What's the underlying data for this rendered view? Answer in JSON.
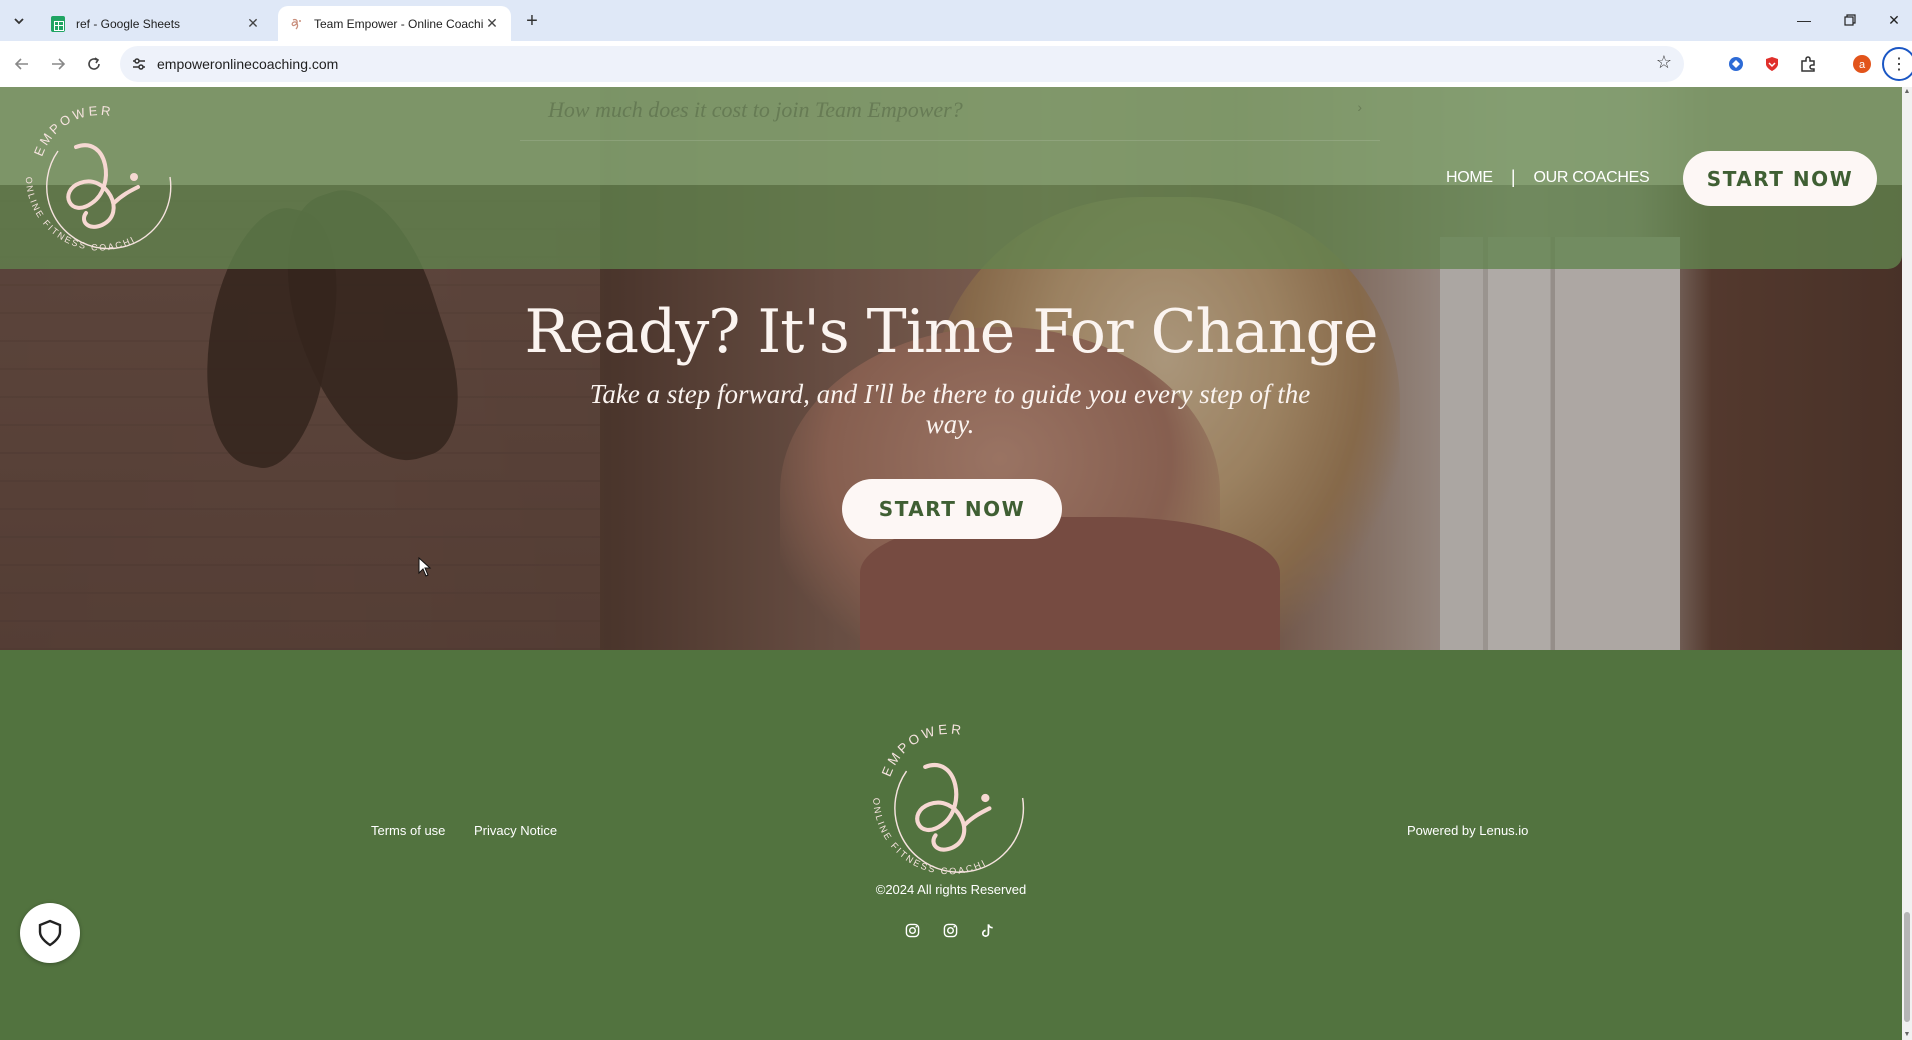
{
  "browser": {
    "tabs": [
      {
        "title": "ref - Google Sheets"
      },
      {
        "title": "Team Empower - Online Coachi"
      }
    ],
    "url": "empoweronlinecoaching.com",
    "profile_initial": "a"
  },
  "page": {
    "ghost_faq": "How much does it cost to join Team Empower?",
    "logo": {
      "top_text": "EMPOWER",
      "bottom_text": "ONLINE FITNESS COACHING"
    },
    "nav": {
      "home": "HOME",
      "separator": "|",
      "coaches": "OUR COACHES",
      "cta": "START NOW"
    },
    "hero": {
      "title": "Ready? It's Time For Change",
      "subtitle": "Take a step forward, and I'll be there to guide you every step of the way.",
      "cta": "START NOW"
    },
    "footer": {
      "terms": "Terms of use",
      "privacy": "Privacy Notice",
      "powered": "Powered by Lenus.io",
      "copyright": "©2024 All rights Reserved",
      "social": [
        "instagram-icon",
        "instagram-icon",
        "tiktok-icon"
      ]
    },
    "colors": {
      "brand_green": "#52733f",
      "button_bg": "#fdf7f5",
      "button_text": "#3f5f33"
    }
  }
}
